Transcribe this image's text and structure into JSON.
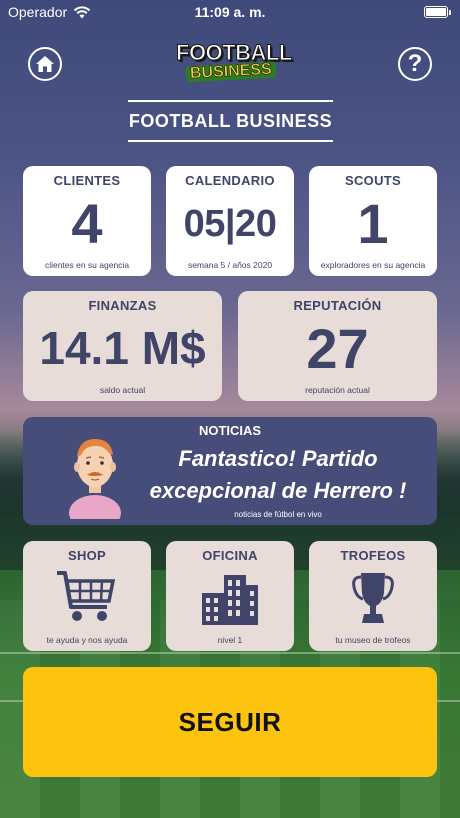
{
  "status_bar": {
    "carrier": "Operador",
    "time": "11:09 a. m."
  },
  "header": {
    "logo_line1": "FOOTBALL",
    "logo_line2": "BUSINESS",
    "help_glyph": "?",
    "title": "FOOTBALL BUSINESS"
  },
  "stats": {
    "clientes": {
      "title": "CLIENTES",
      "value": "4",
      "subtitle": "clientes en su agencia"
    },
    "calendario": {
      "title": "CALENDARIO",
      "value": "05|20",
      "subtitle": "semana 5 / años 2020"
    },
    "scouts": {
      "title": "SCOUTS",
      "value": "1",
      "subtitle": "exploradores en su agencia"
    },
    "finanzas": {
      "title": "FINANZAS",
      "value": "14.1 M$",
      "subtitle": "saldo actual"
    },
    "reputacion": {
      "title": "REPUTACIÓN",
      "value": "27",
      "subtitle": "reputación actual"
    }
  },
  "news": {
    "title": "NOTICIAS",
    "headline": "Fantastico! Partido excepcional de Herrero !",
    "subtitle": "noticias de fútbol en vivo"
  },
  "menu": {
    "shop": {
      "title": "SHOP",
      "subtitle": "te ayuda y nos ayuda",
      "icon": "cart-icon"
    },
    "oficina": {
      "title": "OFICINA",
      "subtitle": "nivel 1",
      "icon": "building-icon"
    },
    "trofeos": {
      "title": "TROFEOS",
      "subtitle": "tu museo de trofeos",
      "icon": "trophy-icon"
    }
  },
  "cta": {
    "label": "SEGUIR"
  },
  "colors": {
    "card_text": "#3f4468",
    "news_bg": "#474d79",
    "card_beige": "#e8dcd8",
    "cta_yellow": "#fcc40f"
  }
}
